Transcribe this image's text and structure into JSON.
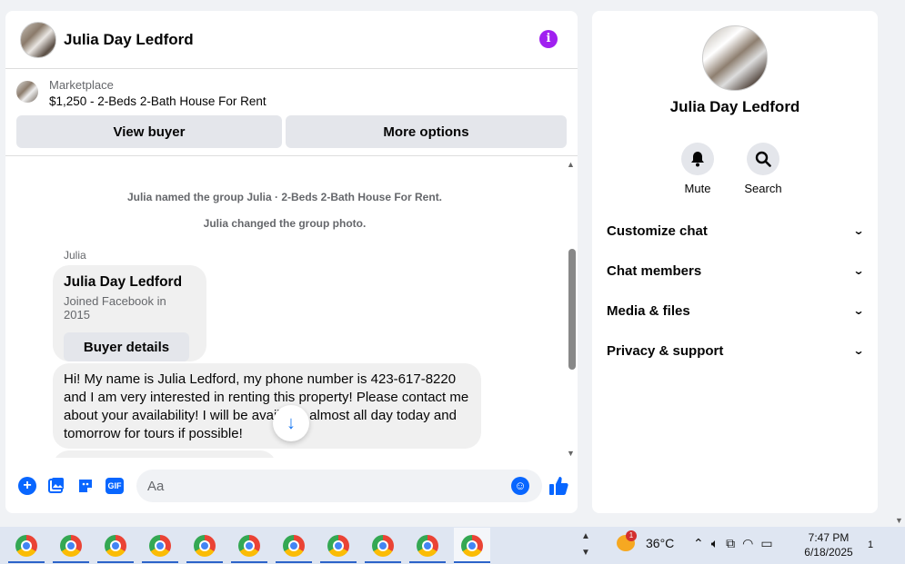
{
  "chat": {
    "title": "Julia Day Ledford",
    "marketplace_label": "Marketplace",
    "listing": "$1,250 - 2-Beds 2-Bath House For Rent",
    "view_buyer": "View buyer",
    "more_options": "More options",
    "system_messages": [
      "Julia named the group Julia · 2-Beds 2-Bath House For Rent.",
      "Julia changed the group photo."
    ],
    "sender": "Julia",
    "card": {
      "name": "Julia Day Ledford",
      "sub": "Joined Facebook in 2015",
      "button": "Buyer details"
    },
    "message": "Hi! My name is Julia Ledford, my phone number is 423-617-8220 and I am very interested in renting this property! Please contact me about your availability! I will be available almost all day today and tomorrow for tours if possible!",
    "composer_placeholder": "Aa",
    "gif_label": "GIF"
  },
  "side": {
    "name": "Julia Day Ledford",
    "actions": [
      "Mute",
      "Search"
    ],
    "sections": [
      "Customize chat",
      "Chat members",
      "Media & files",
      "Privacy & support"
    ]
  },
  "taskbar": {
    "weather": "36°C",
    "weather_badge": "1",
    "time": "7:47 PM",
    "date": "6/18/2025",
    "notif_count": "1"
  },
  "colors": {
    "accent": "#0866ff",
    "info": "#a020f0"
  }
}
